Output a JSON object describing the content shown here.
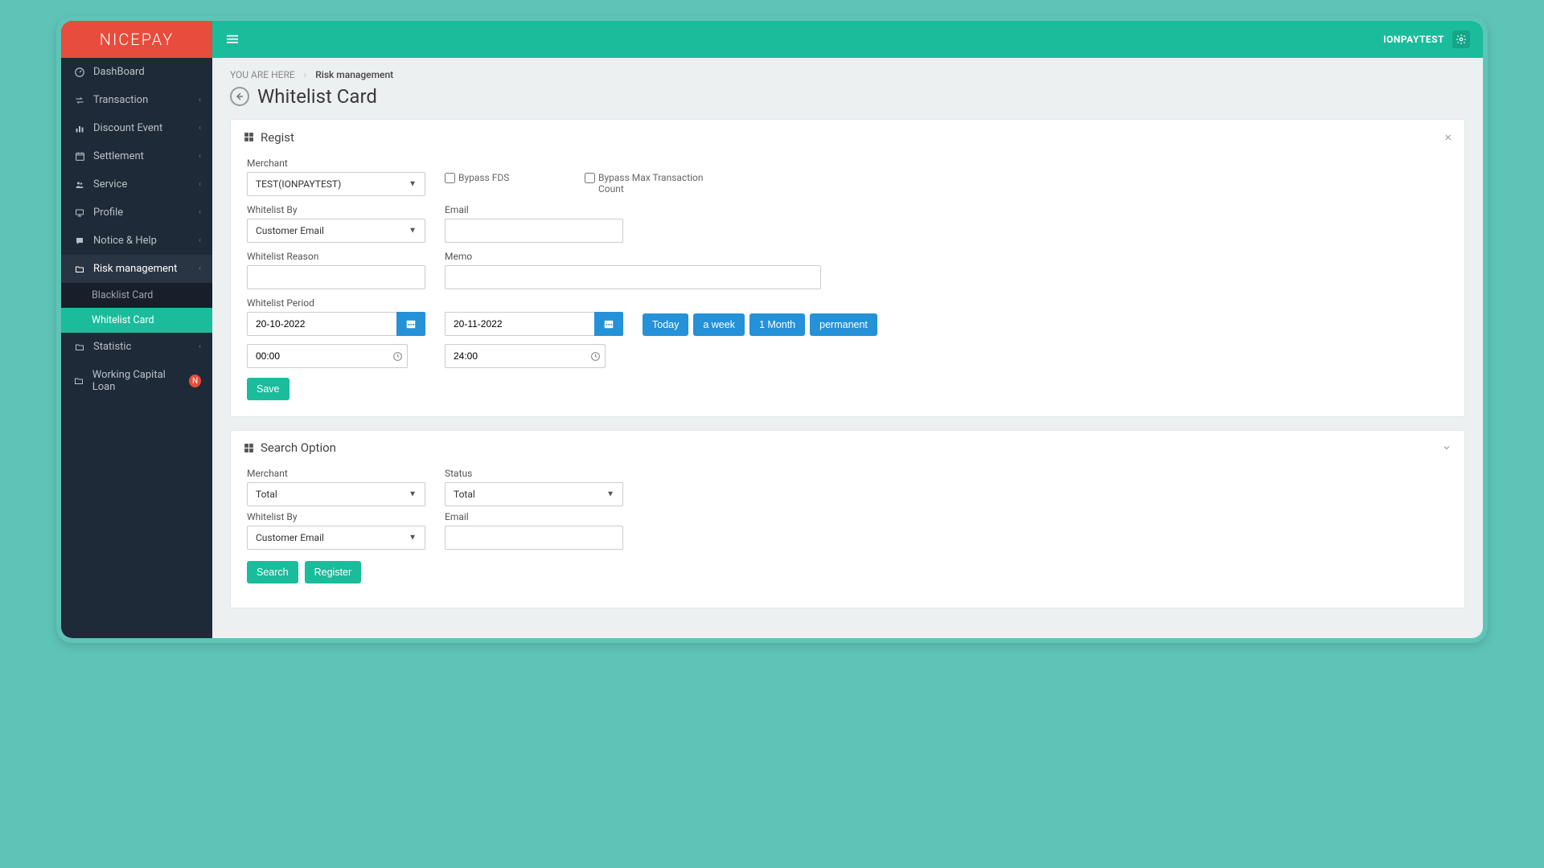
{
  "brand": "NICEPAY",
  "topbar": {
    "user": "IONPAYTEST"
  },
  "sidebar": {
    "items": [
      {
        "label": "DashBoard"
      },
      {
        "label": "Transaction"
      },
      {
        "label": "Discount Event"
      },
      {
        "label": "Settlement"
      },
      {
        "label": "Service"
      },
      {
        "label": "Profile"
      },
      {
        "label": "Notice & Help"
      },
      {
        "label": "Risk management"
      },
      {
        "label": "Statistic"
      },
      {
        "label": "Working Capital Loan"
      }
    ],
    "risk_sub": [
      {
        "label": "Blacklist Card"
      },
      {
        "label": "Whitelist Card"
      }
    ],
    "wcl_badge": "N"
  },
  "breadcrumb": {
    "you_are_here": "YOU ARE HERE",
    "current": "Risk management"
  },
  "page_title": "Whitelist Card",
  "regist": {
    "panel_title": "Regist",
    "merchant_label": "Merchant",
    "merchant_value": "TEST(IONPAYTEST)",
    "bypass_fds_label": "Bypass FDS",
    "bypass_max_label": "Bypass Max Transaction Count",
    "whitelist_by_label": "Whitelist By",
    "whitelist_by_value": "Customer Email",
    "email_label": "Email",
    "reason_label": "Whitelist Reason",
    "memo_label": "Memo",
    "period_label": "Whitelist Period",
    "date_from": "20-10-2022",
    "date_to": "20-11-2022",
    "time_from": "00:00",
    "time_to": "24:00",
    "btn_today": "Today",
    "btn_week": "a week",
    "btn_month": "1 Month",
    "btn_permanent": "permanent",
    "btn_save": "Save"
  },
  "search": {
    "panel_title": "Search Option",
    "merchant_label": "Merchant",
    "merchant_value": "Total",
    "status_label": "Status",
    "status_value": "Total",
    "whitelist_by_label": "Whitelist By",
    "whitelist_by_value": "Customer Email",
    "email_label": "Email",
    "btn_search": "Search",
    "btn_register": "Register"
  }
}
